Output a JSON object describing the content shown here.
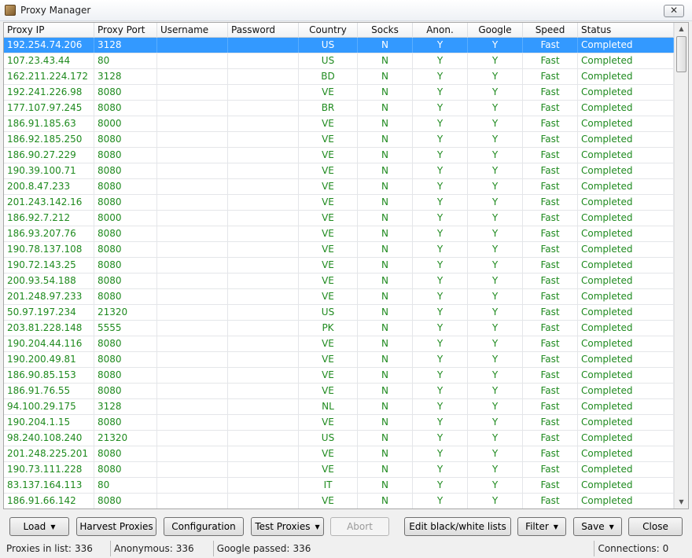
{
  "window": {
    "title": "Proxy Manager",
    "close_label": "✕"
  },
  "table": {
    "columns": [
      "Proxy IP",
      "Proxy Port",
      "Username",
      "Password",
      "Country",
      "Socks",
      "Anon.",
      "Google",
      "Speed",
      "Status"
    ],
    "selected_row": 0,
    "rows": [
      [
        "192.254.74.206",
        "3128",
        "",
        "",
        "US",
        "N",
        "Y",
        "Y",
        "Fast",
        "Completed"
      ],
      [
        "107.23.43.44",
        "80",
        "",
        "",
        "US",
        "N",
        "Y",
        "Y",
        "Fast",
        "Completed"
      ],
      [
        "162.211.224.172",
        "3128",
        "",
        "",
        "BD",
        "N",
        "Y",
        "Y",
        "Fast",
        "Completed"
      ],
      [
        "192.241.226.98",
        "8080",
        "",
        "",
        "VE",
        "N",
        "Y",
        "Y",
        "Fast",
        "Completed"
      ],
      [
        "177.107.97.245",
        "8080",
        "",
        "",
        "BR",
        "N",
        "Y",
        "Y",
        "Fast",
        "Completed"
      ],
      [
        "186.91.185.63",
        "8000",
        "",
        "",
        "VE",
        "N",
        "Y",
        "Y",
        "Fast",
        "Completed"
      ],
      [
        "186.92.185.250",
        "8080",
        "",
        "",
        "VE",
        "N",
        "Y",
        "Y",
        "Fast",
        "Completed"
      ],
      [
        "186.90.27.229",
        "8080",
        "",
        "",
        "VE",
        "N",
        "Y",
        "Y",
        "Fast",
        "Completed"
      ],
      [
        "190.39.100.71",
        "8080",
        "",
        "",
        "VE",
        "N",
        "Y",
        "Y",
        "Fast",
        "Completed"
      ],
      [
        "200.8.47.233",
        "8080",
        "",
        "",
        "VE",
        "N",
        "Y",
        "Y",
        "Fast",
        "Completed"
      ],
      [
        "201.243.142.16",
        "8080",
        "",
        "",
        "VE",
        "N",
        "Y",
        "Y",
        "Fast",
        "Completed"
      ],
      [
        "186.92.7.212",
        "8000",
        "",
        "",
        "VE",
        "N",
        "Y",
        "Y",
        "Fast",
        "Completed"
      ],
      [
        "186.93.207.76",
        "8080",
        "",
        "",
        "VE",
        "N",
        "Y",
        "Y",
        "Fast",
        "Completed"
      ],
      [
        "190.78.137.108",
        "8080",
        "",
        "",
        "VE",
        "N",
        "Y",
        "Y",
        "Fast",
        "Completed"
      ],
      [
        "190.72.143.25",
        "8080",
        "",
        "",
        "VE",
        "N",
        "Y",
        "Y",
        "Fast",
        "Completed"
      ],
      [
        "200.93.54.188",
        "8080",
        "",
        "",
        "VE",
        "N",
        "Y",
        "Y",
        "Fast",
        "Completed"
      ],
      [
        "201.248.97.233",
        "8080",
        "",
        "",
        "VE",
        "N",
        "Y",
        "Y",
        "Fast",
        "Completed"
      ],
      [
        "50.97.197.234",
        "21320",
        "",
        "",
        "US",
        "N",
        "Y",
        "Y",
        "Fast",
        "Completed"
      ],
      [
        "203.81.228.148",
        "5555",
        "",
        "",
        "PK",
        "N",
        "Y",
        "Y",
        "Fast",
        "Completed"
      ],
      [
        "190.204.44.116",
        "8080",
        "",
        "",
        "VE",
        "N",
        "Y",
        "Y",
        "Fast",
        "Completed"
      ],
      [
        "190.200.49.81",
        "8080",
        "",
        "",
        "VE",
        "N",
        "Y",
        "Y",
        "Fast",
        "Completed"
      ],
      [
        "186.90.85.153",
        "8080",
        "",
        "",
        "VE",
        "N",
        "Y",
        "Y",
        "Fast",
        "Completed"
      ],
      [
        "186.91.76.55",
        "8080",
        "",
        "",
        "VE",
        "N",
        "Y",
        "Y",
        "Fast",
        "Completed"
      ],
      [
        "94.100.29.175",
        "3128",
        "",
        "",
        "NL",
        "N",
        "Y",
        "Y",
        "Fast",
        "Completed"
      ],
      [
        "190.204.1.15",
        "8080",
        "",
        "",
        "VE",
        "N",
        "Y",
        "Y",
        "Fast",
        "Completed"
      ],
      [
        "98.240.108.240",
        "21320",
        "",
        "",
        "US",
        "N",
        "Y",
        "Y",
        "Fast",
        "Completed"
      ],
      [
        "201.248.225.201",
        "8080",
        "",
        "",
        "VE",
        "N",
        "Y",
        "Y",
        "Fast",
        "Completed"
      ],
      [
        "190.73.111.228",
        "8080",
        "",
        "",
        "VE",
        "N",
        "Y",
        "Y",
        "Fast",
        "Completed"
      ],
      [
        "83.137.164.113",
        "80",
        "",
        "",
        "IT",
        "N",
        "Y",
        "Y",
        "Fast",
        "Completed"
      ],
      [
        "186.91.66.142",
        "8080",
        "",
        "",
        "VE",
        "N",
        "Y",
        "Y",
        "Fast",
        "Completed"
      ]
    ]
  },
  "buttons": {
    "load": "Load",
    "harvest": "Harvest Proxies",
    "configuration": "Configuration",
    "test": "Test Proxies",
    "abort": "Abort",
    "edit_lists": "Edit black/white lists",
    "filter": "Filter",
    "save": "Save",
    "close": "Close"
  },
  "status": {
    "proxies_label": "Proxies in list:",
    "proxies_value": "336",
    "anon_label": "Anonymous:",
    "anon_value": "336",
    "google_label": "Google passed:",
    "google_value": "336",
    "connections_label": "Connections:",
    "connections_value": "0"
  },
  "colors": {
    "row_text": "#1e8a1e",
    "selection": "#3399ff"
  }
}
